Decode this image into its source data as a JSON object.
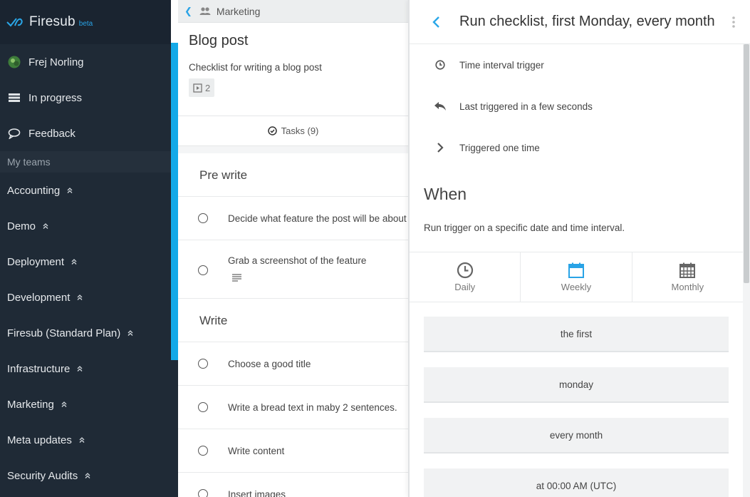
{
  "app": {
    "name": "Firesub",
    "badge": "beta",
    "accent_color": "#13a9e8",
    "sidebar_color": "#1f2a36"
  },
  "sidebar": {
    "user": {
      "name": "Frej Norling",
      "icon": "avatar"
    },
    "items": [
      {
        "label": "In progress",
        "icon": "stack-icon"
      },
      {
        "label": "Feedback",
        "icon": "chat-bubble-icon"
      }
    ],
    "section_label": "My teams",
    "teams": [
      {
        "label": "Accounting"
      },
      {
        "label": "Demo"
      },
      {
        "label": "Deployment"
      },
      {
        "label": "Development"
      },
      {
        "label": "Firesub (Standard Plan)"
      },
      {
        "label": "Infrastructure"
      },
      {
        "label": "Marketing"
      },
      {
        "label": "Meta updates"
      },
      {
        "label": "Security Audits"
      }
    ]
  },
  "checklist": {
    "breadcrumb": "Marketing",
    "title": "Blog post",
    "description": "Checklist for writing a blog post",
    "run_count": "2",
    "tasks_tab": {
      "label": "Tasks",
      "count": "(9)"
    },
    "groups": [
      {
        "title": "Pre write",
        "tasks": [
          {
            "text": "Decide what feature the post will be about"
          },
          {
            "text": "Grab a screenshot of the feature",
            "has_note": true
          }
        ]
      },
      {
        "title": "Write",
        "tasks": [
          {
            "text": "Choose a good title"
          },
          {
            "text": "Write a bread text in maby 2 sentences."
          },
          {
            "text": "Write content"
          },
          {
            "text": "Insert images"
          }
        ]
      }
    ]
  },
  "trigger_panel": {
    "title": "Run checklist, first Monday, every month",
    "meta": [
      {
        "text": "Time interval trigger",
        "icon": "clock-icon"
      },
      {
        "text": "Last triggered in a few seconds",
        "icon": "reply-arrow-icon"
      },
      {
        "text": "Triggered one time",
        "icon": "chevron-right-icon"
      }
    ],
    "when_title": "When",
    "when_description": "Run trigger on a specific date and time interval.",
    "frequency_tabs": [
      {
        "label": "Daily",
        "icon": "clock-icon",
        "active": false
      },
      {
        "label": "Weekly",
        "icon": "calendar-icon",
        "active": true
      },
      {
        "label": "Monthly",
        "icon": "calendar-grid-icon",
        "active": false
      }
    ],
    "options": [
      {
        "value": "the first"
      },
      {
        "value": "monday"
      },
      {
        "value": "every month"
      },
      {
        "value": "at 00:00 AM (UTC)"
      }
    ]
  }
}
